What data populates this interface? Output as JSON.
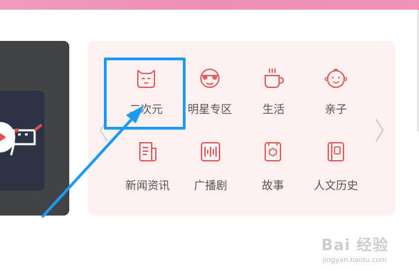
{
  "colors": {
    "accent": "#e06060",
    "highlight": "#1a9af4",
    "panel_bg": "#fdf1f1",
    "label": "#555555"
  },
  "categories": [
    {
      "label": "二次元",
      "icon": "cat-face-icon"
    },
    {
      "label": "明星专区",
      "icon": "sunglasses-face-icon"
    },
    {
      "label": "生活",
      "icon": "coffee-cup-icon"
    },
    {
      "label": "亲子",
      "icon": "baby-face-icon"
    },
    {
      "label": "新闻资讯",
      "icon": "newspaper-icon"
    },
    {
      "label": "广播剧",
      "icon": "audio-wave-icon"
    },
    {
      "label": "故事",
      "icon": "story-book-icon"
    },
    {
      "label": "人文历史",
      "icon": "notebook-icon"
    }
  ],
  "navigation": {
    "prev_icon": "chevron-left-icon",
    "next_icon": "chevron-right-icon"
  },
  "watermark": {
    "main": "Bai 经验",
    "sub": "jingyan.baidu.com"
  }
}
